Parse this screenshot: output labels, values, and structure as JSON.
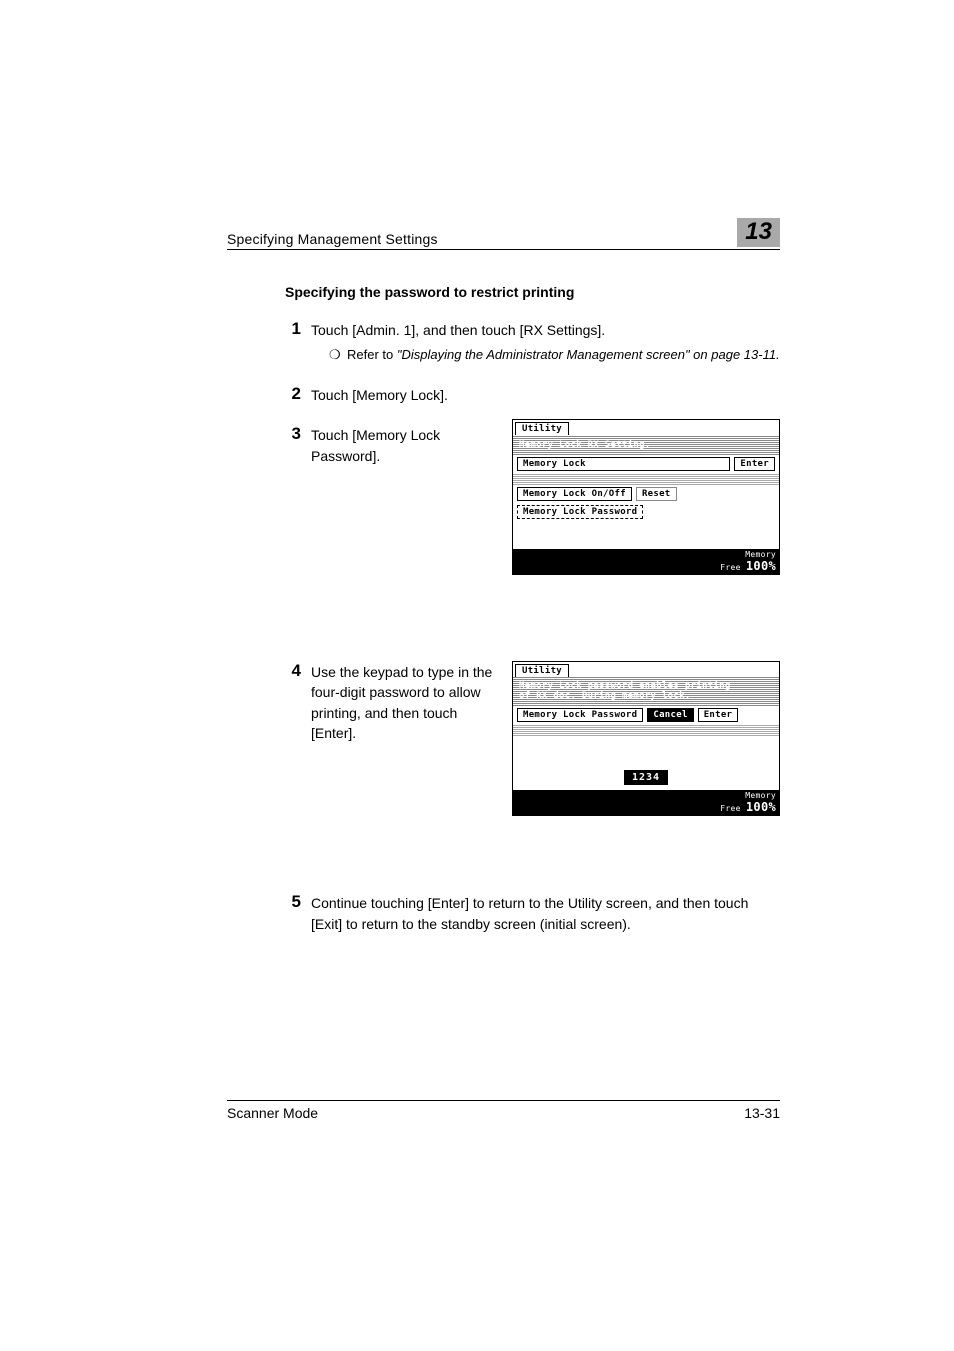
{
  "header": {
    "title": "Specifying Management Settings",
    "chapter": "13"
  },
  "section_heading": "Specifying the password to restrict printing",
  "steps": {
    "s1": {
      "num": "1",
      "text": "Touch [Admin. 1], and then touch [RX Settings].",
      "sub_bullet": "❍",
      "sub_prefix": "Refer to ",
      "sub_italic": "\"Displaying the Administrator Management screen\" on page 13-11.",
      "sub_suffix": ""
    },
    "s2": {
      "num": "2",
      "text": "Touch [Memory Lock]."
    },
    "s3": {
      "num": "3",
      "text": "Touch [Memory Lock Password]."
    },
    "s4": {
      "num": "4",
      "text": "Use the keypad to type in the four-digit password to allow printing, and then touch [Enter]."
    },
    "s5": {
      "num": "5",
      "text": "Continue touching [Enter] to return to the Utility screen, and then touch [Exit] to return to the standby screen (initial screen)."
    }
  },
  "screen1": {
    "tab": "Utility",
    "line1": "Memory Lock RX Setting.",
    "chip1": "Memory Lock",
    "enter": "Enter",
    "chip2": "Memory Lock On/Off",
    "reset": "Reset",
    "chip3": "Memory Lock Password",
    "mem_label": "Memory\nFree",
    "mem_val": "100%"
  },
  "screen2": {
    "tab": "Utility",
    "line1": "Memory Lock password enables printing",
    "line2": "of RX doc. During memory lock.",
    "chip1": "Memory Lock Password",
    "cancel": "Cancel",
    "enter": "Enter",
    "value": "1234",
    "mem_label": "Memory\nFree",
    "mem_val": "100%"
  },
  "footer": {
    "left": "Scanner Mode",
    "right": "13-31"
  }
}
